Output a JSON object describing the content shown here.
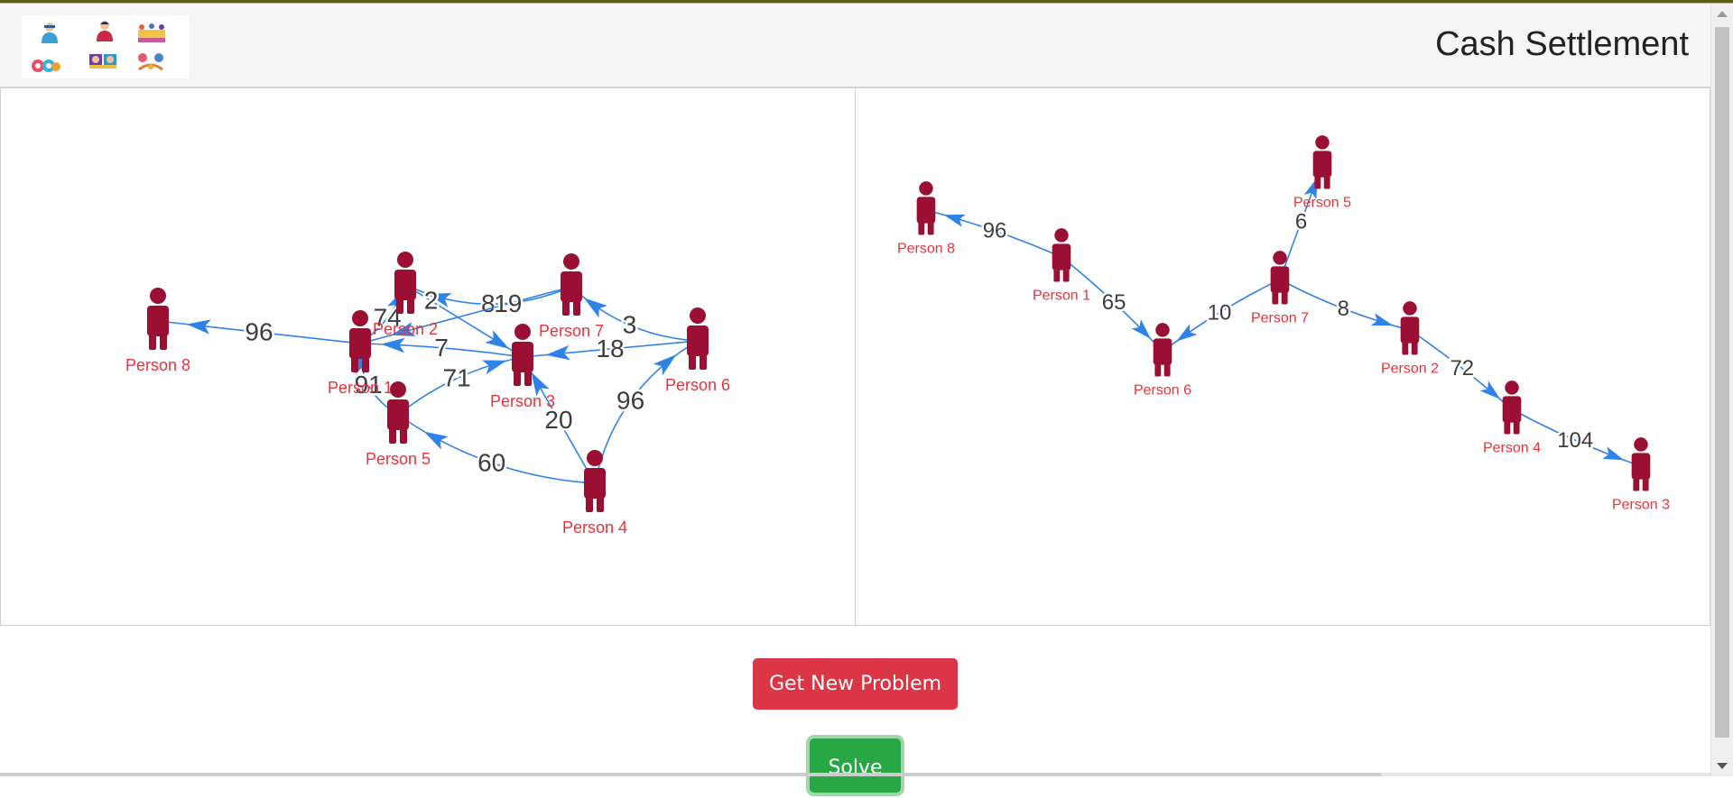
{
  "header": {
    "title": "Cash Settlement",
    "logo_icons": [
      "people-icon",
      "person-icon",
      "group-icon",
      "avatars-icon",
      "cards-icon",
      "network-icon"
    ]
  },
  "colors": {
    "person": "#9b0f33",
    "edge": "#2f83e8",
    "label": "#e8323c",
    "weight": "#3d3d3d"
  },
  "graphs": {
    "problem": {
      "nodes": [
        {
          "id": "p1",
          "label": "Person 1"
        },
        {
          "id": "p2",
          "label": "Person 2"
        },
        {
          "id": "p3",
          "label": "Person 3"
        },
        {
          "id": "p4",
          "label": "Person 4"
        },
        {
          "id": "p5",
          "label": "Person 5"
        },
        {
          "id": "p6",
          "label": "Person 6"
        },
        {
          "id": "p7",
          "label": "Person 7"
        },
        {
          "id": "p8",
          "label": "Person 8"
        }
      ],
      "edges": [
        {
          "from": "p7",
          "to": "p2",
          "weight": "8"
        },
        {
          "from": "p6",
          "to": "p7",
          "weight": "3"
        },
        {
          "from": "p2",
          "to": "p3",
          "weight": "2"
        },
        {
          "from": "p7",
          "to": "p1",
          "weight": "19"
        },
        {
          "from": "p1",
          "to": "p2",
          "weight": "74"
        },
        {
          "from": "p1",
          "to": "p8",
          "weight": "96"
        },
        {
          "from": "p3",
          "to": "p1",
          "weight": "7"
        },
        {
          "from": "p6",
          "to": "p3",
          "weight": "18"
        },
        {
          "from": "p5",
          "to": "p1",
          "weight": "91"
        },
        {
          "from": "p5",
          "to": "p3",
          "weight": "71"
        },
        {
          "from": "p4",
          "to": "p3",
          "weight": "20"
        },
        {
          "from": "p4",
          "to": "p6",
          "weight": "96"
        },
        {
          "from": "p4",
          "to": "p5",
          "weight": "60"
        }
      ]
    },
    "solution": {
      "nodes": [
        {
          "id": "p8",
          "label": "Person 8"
        },
        {
          "id": "p1",
          "label": "Person 1"
        },
        {
          "id": "p6",
          "label": "Person 6"
        },
        {
          "id": "p7",
          "label": "Person 7"
        },
        {
          "id": "p5",
          "label": "Person 5"
        },
        {
          "id": "p2",
          "label": "Person 2"
        },
        {
          "id": "p4",
          "label": "Person 4"
        },
        {
          "id": "p3",
          "label": "Person 3"
        }
      ],
      "edges": [
        {
          "from": "p1",
          "to": "p8",
          "weight": "96"
        },
        {
          "from": "p1",
          "to": "p6",
          "weight": "65"
        },
        {
          "from": "p7",
          "to": "p6",
          "weight": "10"
        },
        {
          "from": "p7",
          "to": "p5",
          "weight": "6"
        },
        {
          "from": "p7",
          "to": "p2",
          "weight": "8"
        },
        {
          "from": "p2",
          "to": "p4",
          "weight": "72"
        },
        {
          "from": "p4",
          "to": "p3",
          "weight": "104"
        }
      ]
    }
  },
  "actions": {
    "new_problem_label": "Get New Problem",
    "solve_label": "Solve"
  }
}
